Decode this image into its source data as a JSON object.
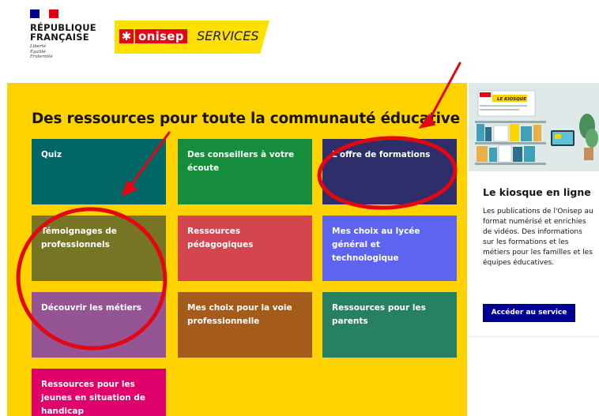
{
  "header": {
    "republic_line1": "RÉPUBLIQUE",
    "republic_line2": "FRANÇAISE",
    "motto": [
      "Liberté",
      "Égalité",
      "Fraternité"
    ],
    "onisep_star": "✱",
    "onisep_word": "onisep",
    "onisep_services": "SERVICES"
  },
  "main": {
    "title": "Des ressources pour toute la communauté éducative",
    "panel_color": "#ffd200",
    "tiles": [
      {
        "label": "Quiz",
        "color": "#006666"
      },
      {
        "label": "Des conseillers à votre écoute",
        "color": "#168d3c"
      },
      {
        "label": "L'offre de formations",
        "color": "#2e2e6a"
      },
      {
        "label": "Témoignages de professionnels",
        "color": "#757524"
      },
      {
        "label": "Ressources pédagogiques",
        "color": "#d3454f"
      },
      {
        "label": "Mes choix au lycée général et technologique",
        "color": "#5e64f0"
      },
      {
        "label": "Découvrir les métiers",
        "color": "#955595"
      },
      {
        "label": "Mes choix pour la voie professionnelle",
        "color": "#a55c1a"
      },
      {
        "label": "Ressources pour les parents",
        "color": "#278062"
      },
      {
        "label": "Ressources pour les jeunes en situation de handicap",
        "color": "#e0006c"
      }
    ]
  },
  "kiosk": {
    "title": "Le kiosque en ligne",
    "description": "Les publications de l'Onisep au format numérisé et enrichies de vidéos. Des informations sur les formations et les métiers pour les familles et les équipes éducatives.",
    "button_label": "Accéder au service",
    "button_color": "#000091",
    "cover_badge": "LE KIOSQUE"
  },
  "annotations": {
    "color": "#e30613"
  }
}
